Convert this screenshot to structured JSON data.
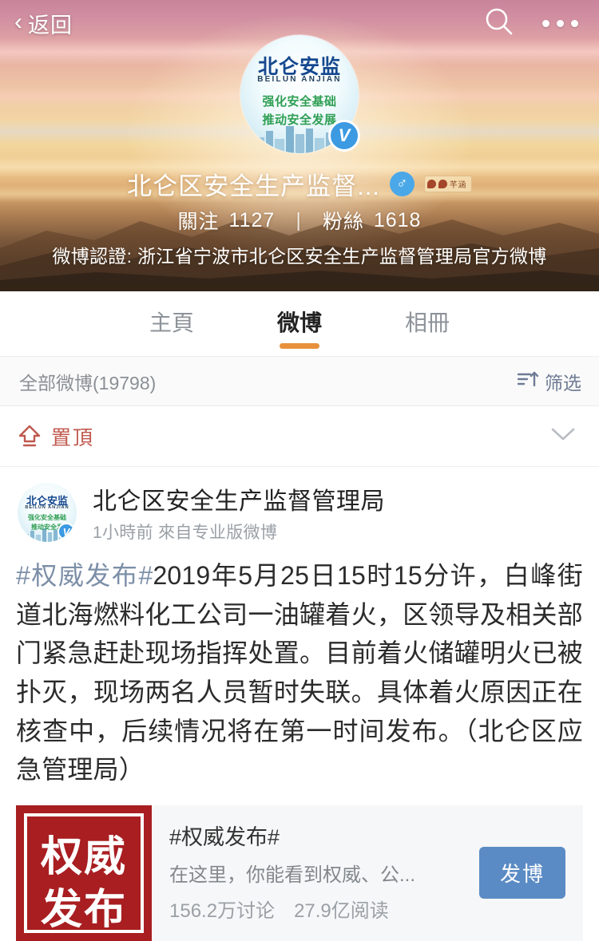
{
  "topbar": {
    "back_label": "返回",
    "search_icon": "search-icon",
    "more_icon": "more-dots-icon"
  },
  "profile": {
    "avatar": {
      "line1": "北仑安监",
      "line2": "BEILUN ANJIAN",
      "line3": "强化安全基础",
      "line4": "推动安全发展",
      "verified_badge": "V"
    },
    "username": "北仑区安全生产监督...",
    "gender_icon": "male-icon",
    "gender_symbol": "♂",
    "medal_text": "芊涵",
    "follow_label": "關注",
    "follow_count": "1127",
    "separator": "|",
    "fans_label": "粉絲",
    "fans_count": "1618",
    "verify_line": "微博認證: 浙江省宁波市北仑区安全生产监督管理局官方微博"
  },
  "tabs": [
    {
      "label": "主頁",
      "active": false
    },
    {
      "label": "微博",
      "active": true
    },
    {
      "label": "相冊",
      "active": false
    }
  ],
  "filterbar": {
    "all_weibo": "全部微博(19798)",
    "filter_label": "筛选",
    "filter_icon": "filter-sort-icon"
  },
  "pinned": {
    "icon": "pin-top-icon",
    "label": "置頂",
    "collapse_icon": "chevron-down-icon"
  },
  "post": {
    "author": "北仑区安全生产监督管理局",
    "time": "1小時前",
    "source": "來自专业版微博",
    "hashtag": "#权威发布#",
    "text": "2019年5月25日15时15分许，白峰街道北海燃料化工公司一油罐着火，区领导及相关部门紧急赶赴现场指挥处置。目前着火储罐明火已被扑灭，现场两名人员暂时失联。具体着火原因正在核查中，后续情况将在第一时间发布。（北仑区应急管理局）",
    "avatar": {
      "line1": "北仑安监",
      "line2": "BEILUN ANJIAN",
      "line3": "强化安全基础",
      "line4": "推动安全发",
      "verified_badge": "V"
    }
  },
  "topic_card": {
    "thumb_line1": "权威",
    "thumb_line2": "发布",
    "title": "#权威发布#",
    "description": "在这里，你能看到权威、公...",
    "discussions": "156.2万讨论",
    "reads": "27.9亿阅读",
    "button_label": "发博"
  },
  "colors": {
    "accent_orange": "#e8913c",
    "pinned_red": "#c0584e",
    "topic_red": "#a81e21",
    "button_blue": "#5b8bc4",
    "verified_blue": "#3c9ae2",
    "hashtag_blue": "#7c8fa8"
  }
}
